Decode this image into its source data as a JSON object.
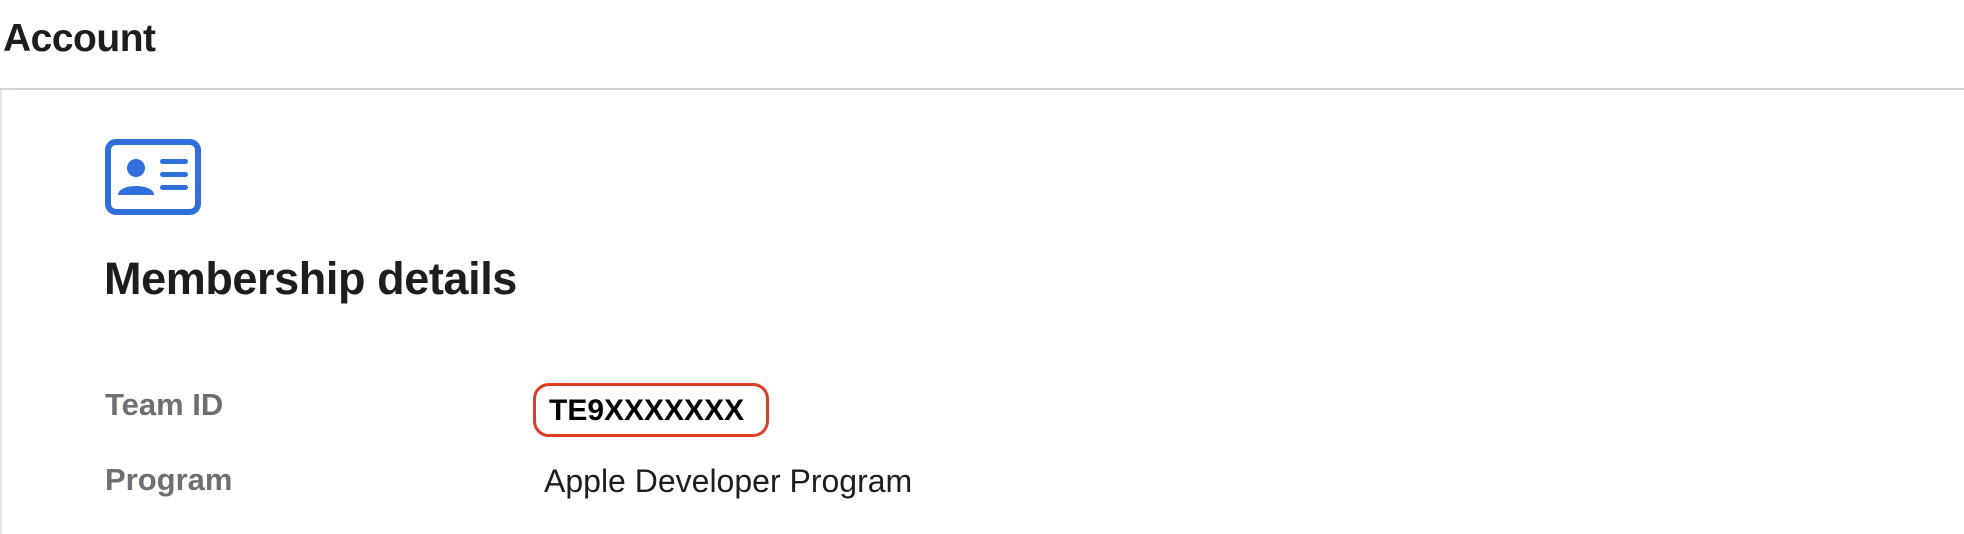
{
  "header": {
    "title": "Account"
  },
  "membership": {
    "icon": "contact-card-icon",
    "title": "Membership details",
    "rows": [
      {
        "label": "Team ID",
        "value": "TE9XXXXXXX"
      },
      {
        "label": "Program",
        "value": "Apple Developer Program"
      }
    ]
  },
  "colors": {
    "accent_blue": "#2f6fdc",
    "highlight_red": "#e03c23",
    "label_gray": "#6e6e73",
    "divider": "#d2d2d7"
  }
}
